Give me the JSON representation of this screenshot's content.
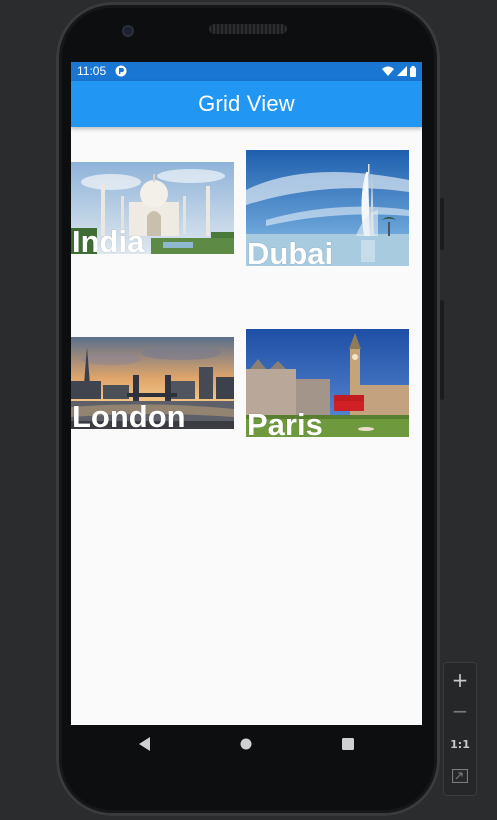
{
  "status_bar": {
    "time": "11:05",
    "background": "#1976d2",
    "icons": [
      "app-notification-icon",
      "wifi-icon",
      "cell-signal-icon",
      "battery-icon"
    ]
  },
  "app_bar": {
    "title": "Grid View",
    "background": "#2196f3"
  },
  "grid": {
    "items": [
      {
        "label": "India",
        "image": "taj-mahal-photo"
      },
      {
        "label": "Dubai",
        "image": "burj-al-arab-photo"
      },
      {
        "label": "London",
        "image": "london-skyline-photo"
      },
      {
        "label": "Paris",
        "image": "big-ben-photo"
      }
    ]
  },
  "navigation_bar": {
    "buttons": [
      "back-icon",
      "home-icon",
      "recents-icon"
    ]
  },
  "emulator_controls": {
    "zoom_in": "+",
    "zoom_out": "−",
    "actual_size": "1:1",
    "fit_icon": "fit-screen-icon"
  }
}
